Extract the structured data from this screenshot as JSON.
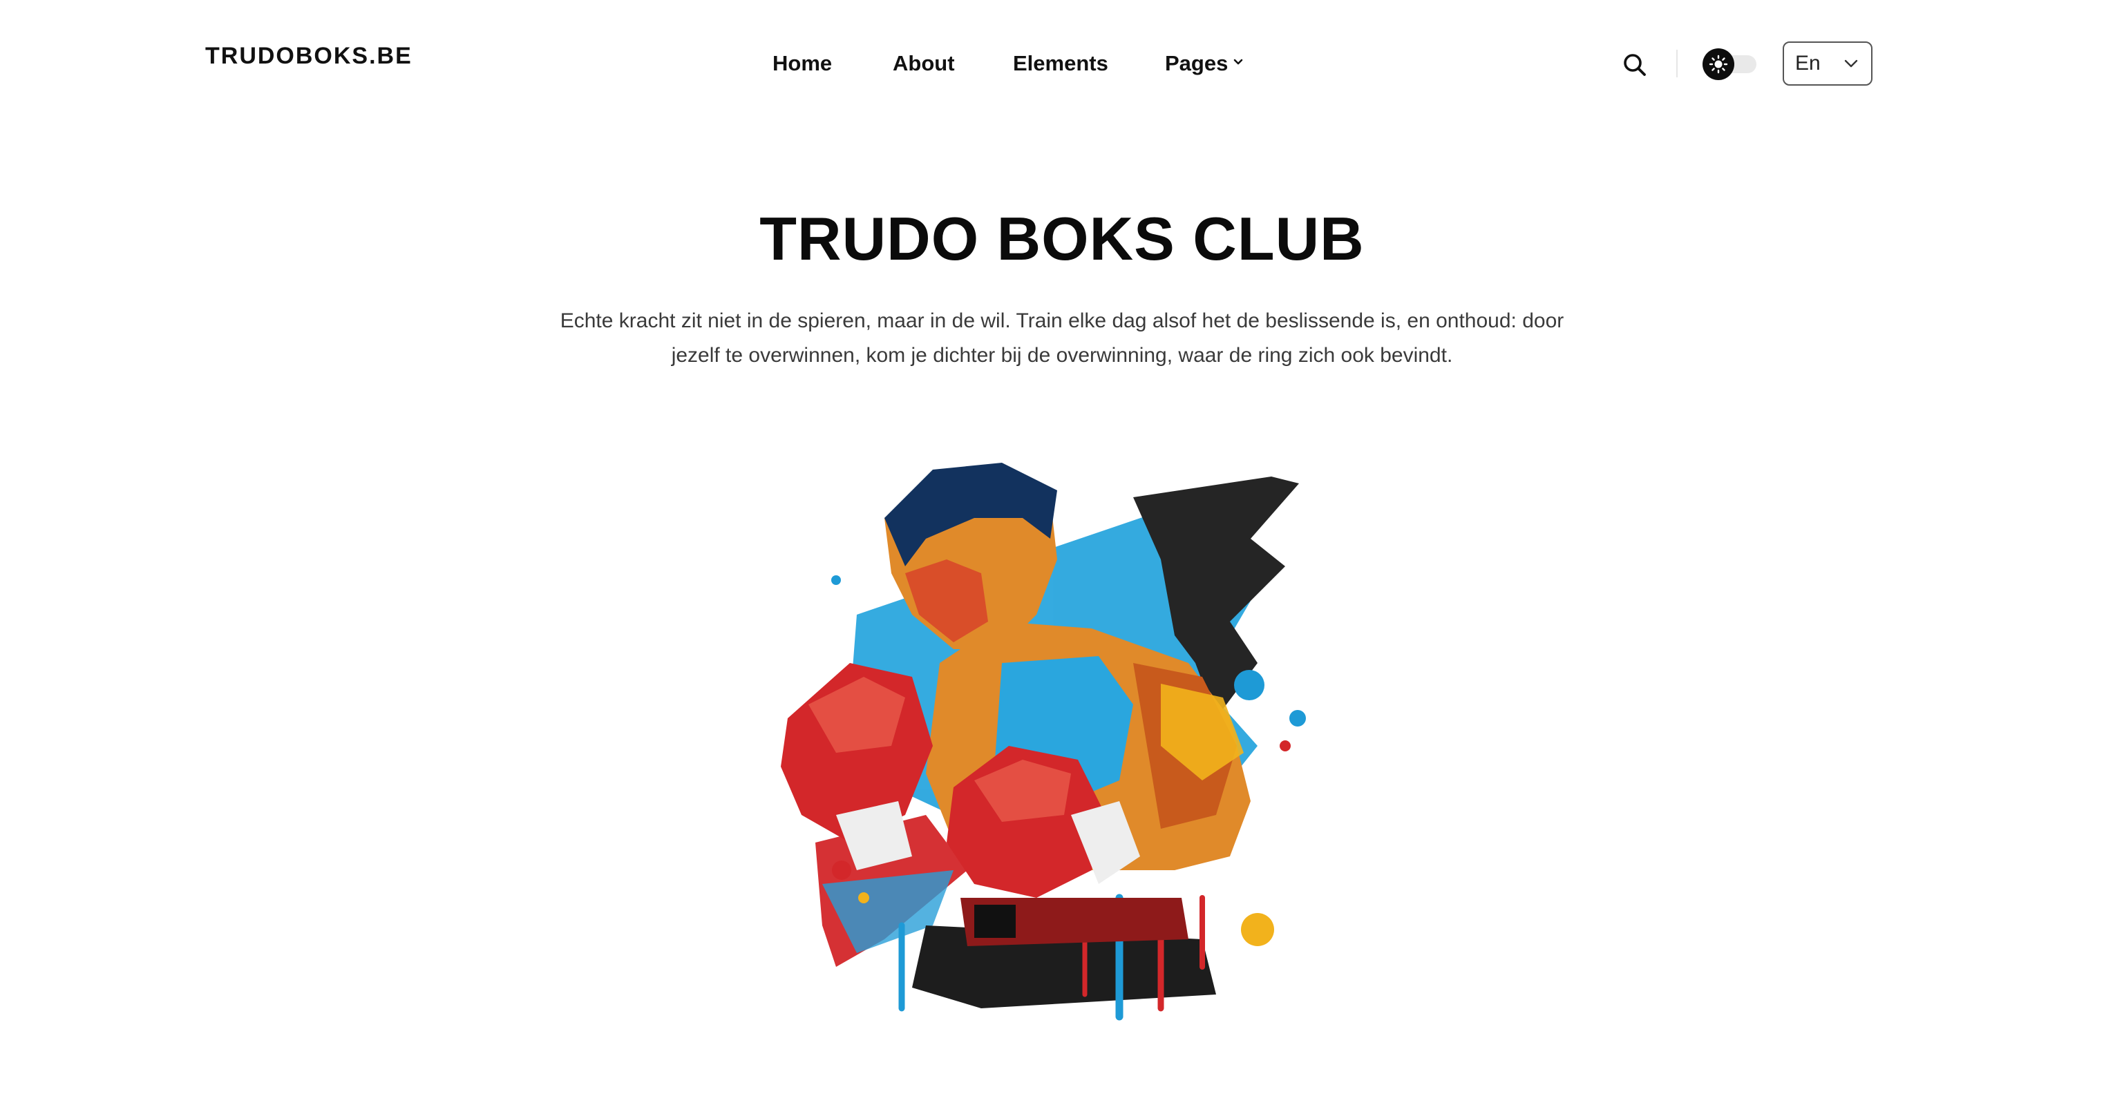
{
  "header": {
    "logo": "TRUDOBOKS.BE",
    "nav": [
      {
        "label": "Home"
      },
      {
        "label": "About"
      },
      {
        "label": "Elements"
      },
      {
        "label": "Pages",
        "has_dropdown": true
      }
    ],
    "search_icon": "search-icon",
    "theme_toggle_icon": "sun-icon",
    "language": {
      "selected": "En",
      "icon": "chevron-down-icon"
    }
  },
  "hero": {
    "title": "TRUDO BOKS CLUB",
    "text": "Echte kracht zit niet in de spieren, maar in de wil. Train elke dag alsof het de beslissende is, en onthoud: door jezelf te overwinnen, kom je dichter bij de overwinning, waar de ring zich ook bevindt."
  },
  "colors": {
    "text": "#111111",
    "muted_text": "#3a3a3a",
    "accent_red": "#d3272a",
    "accent_blue": "#1e9ad6",
    "accent_yellow": "#f2b21c"
  }
}
